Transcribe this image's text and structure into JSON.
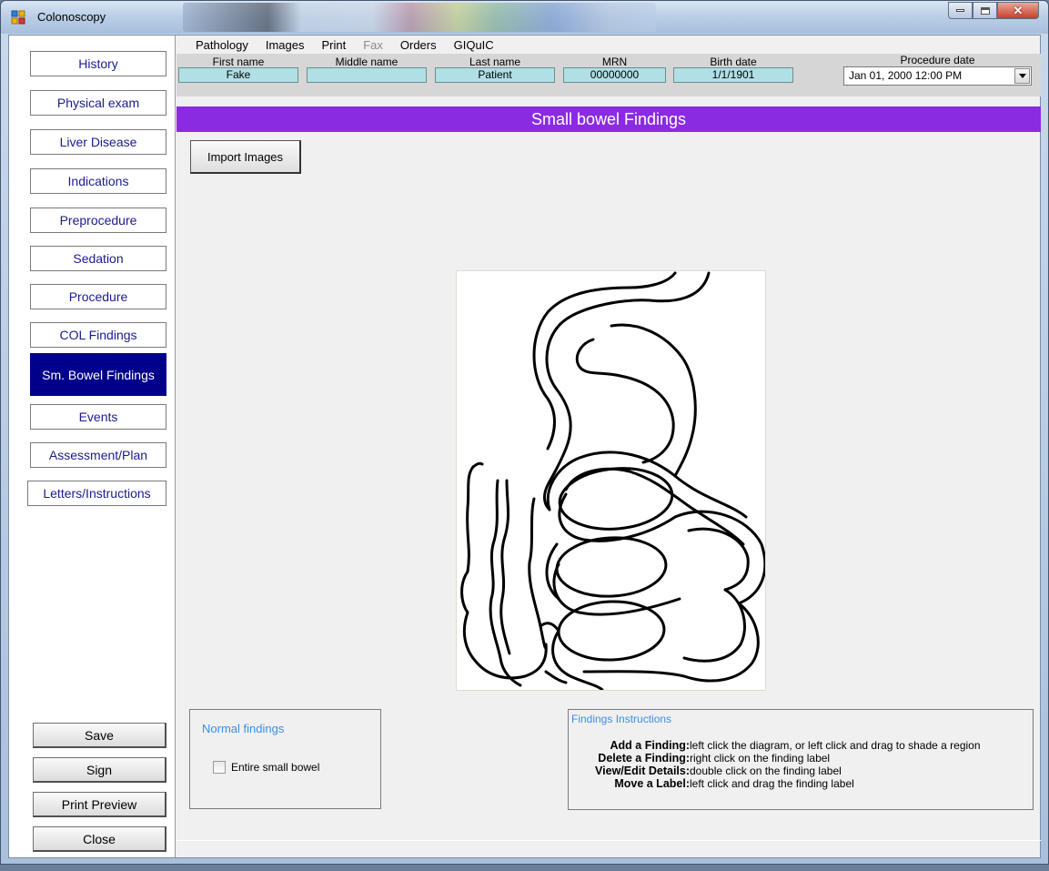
{
  "window": {
    "title": "Colonoscopy",
    "controls": [
      "minimize-icon",
      "maximize-icon",
      "close-icon"
    ]
  },
  "sidebar": {
    "nav": [
      {
        "label": "History"
      },
      {
        "label": "Physical exam"
      },
      {
        "label": "Liver Disease"
      },
      {
        "label": "Indications"
      },
      {
        "label": "Preprocedure"
      },
      {
        "label": "Sedation"
      },
      {
        "label": "Procedure"
      },
      {
        "label": "COL Findings"
      },
      {
        "label": "Sm. Bowel Findings",
        "active": true
      },
      {
        "label": "Events"
      },
      {
        "label": "Assessment/Plan"
      },
      {
        "label": "Letters/Instructions"
      }
    ],
    "actions": [
      {
        "label": "Save"
      },
      {
        "label": "Sign"
      },
      {
        "label": "Print Preview"
      },
      {
        "label": "Close"
      }
    ]
  },
  "menu": [
    {
      "label": "Pathology",
      "enabled": true
    },
    {
      "label": "Images",
      "enabled": true
    },
    {
      "label": "Print",
      "enabled": true
    },
    {
      "label": "Fax",
      "enabled": false
    },
    {
      "label": "Orders",
      "enabled": true
    },
    {
      "label": "GIQuIC",
      "enabled": true
    }
  ],
  "patient": {
    "first_name_label": "First name",
    "first_name": "Fake",
    "middle_name_label": "Middle name",
    "middle_name": "",
    "last_name_label": "Last name",
    "last_name": "Patient",
    "mrn_label": "MRN",
    "mrn": "00000000",
    "birth_date_label": "Birth date",
    "birth_date": "1/1/1901",
    "procedure_date_label": "Procedure date",
    "procedure_date": "Jan 01, 2000 12:00 PM"
  },
  "section": {
    "title": "Small bowel Findings",
    "color": "#8a2be2",
    "import_button": "Import Images"
  },
  "normal_findings": {
    "title": "Normal findings",
    "checkbox_label": "Entire small bowel",
    "checked": false
  },
  "instructions": {
    "title": "Findings Instructions",
    "rows": [
      {
        "key": "Add a Finding:",
        "text": "left click the diagram, or left click and drag to shade a region"
      },
      {
        "key": "Delete a Finding:",
        "text": "right click on the finding label"
      },
      {
        "key": "View/Edit Details:",
        "text": "double click on the finding label"
      },
      {
        "key": "Move a Label:",
        "text": "left click and drag the finding label"
      }
    ]
  },
  "colors": {
    "nav_text": "#1b1b8f",
    "nav_active_bg": "#00008b",
    "field_bg": "#b0e0e6",
    "group_title": "#3a8ee6"
  }
}
